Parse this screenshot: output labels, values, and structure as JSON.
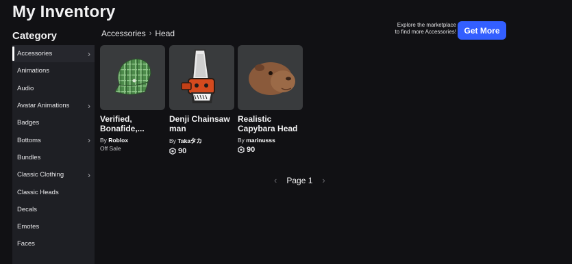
{
  "header": {
    "title": "My Inventory"
  },
  "sidebar": {
    "heading": "Category",
    "items": [
      {
        "label": "Accessories",
        "chevron": true,
        "selected": true
      },
      {
        "label": "Animations",
        "chevron": false
      },
      {
        "label": "Audio",
        "chevron": false
      },
      {
        "label": "Avatar Animations",
        "chevron": true
      },
      {
        "label": "Badges",
        "chevron": false
      },
      {
        "label": "Bottoms",
        "chevron": true
      },
      {
        "label": "Bundles",
        "chevron": false
      },
      {
        "label": "Classic Clothing",
        "chevron": true
      },
      {
        "label": "Classic Heads",
        "chevron": false
      },
      {
        "label": "Decals",
        "chevron": false
      },
      {
        "label": "Emotes",
        "chevron": false
      },
      {
        "label": "Faces",
        "chevron": false
      }
    ]
  },
  "breadcrumb": {
    "parent": "Accessories",
    "separator": "›",
    "current": "Head"
  },
  "promo": {
    "text_line1": "Explore the marketplace",
    "text_line2": "to find more Accessories!",
    "button_label": "Get More",
    "button_color": "#335fff"
  },
  "items": [
    {
      "name_line1": "Verified,",
      "name_line2": "Bonafide,...",
      "by": "By",
      "creator": "Roblox",
      "status": "Off Sale",
      "thumb_icon": "green-plaid-cap-icon"
    },
    {
      "name_line1": "Denji Chainsaw",
      "name_line2": "man",
      "by": "By",
      "creator": "Takaタカ",
      "price": "90",
      "thumb_icon": "chainsaw-head-icon"
    },
    {
      "name_line1": "Realistic",
      "name_line2": "Capybara Head",
      "by": "By",
      "creator": "marinusss",
      "price": "90",
      "thumb_icon": "capybara-head-icon"
    }
  ],
  "pagination": {
    "label": "Page 1",
    "prev": "‹",
    "next": "›"
  },
  "colors": {
    "background": "#111114",
    "sidebar": "#1e1f24",
    "card": "#393b3d",
    "accent": "#335fff"
  }
}
